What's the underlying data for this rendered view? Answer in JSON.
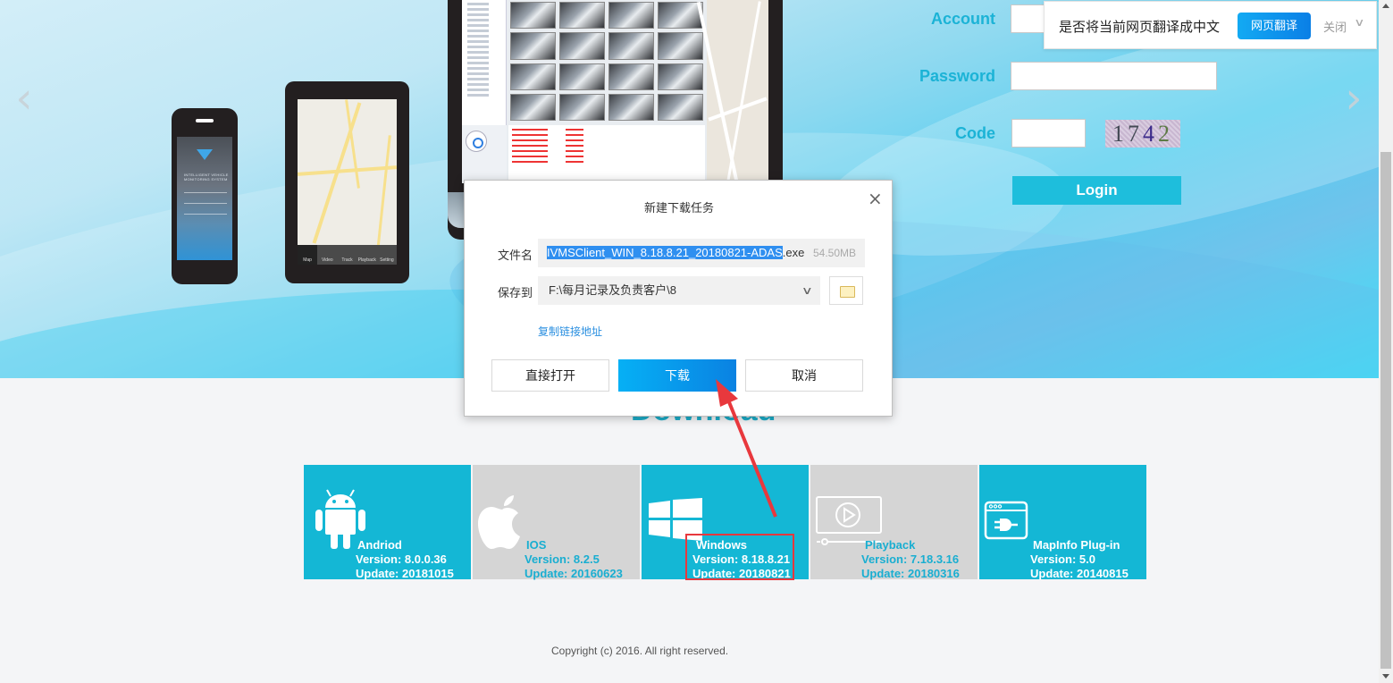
{
  "hero": {
    "prev_arrow": "‹",
    "next_arrow": "›",
    "phone_brand": "INTELLIGENT VEHICLE MONITORING SYSTEM",
    "tablet_tabs": [
      "Map",
      "Video",
      "Track",
      "Playback",
      "Setting"
    ]
  },
  "login": {
    "account_label": "Account",
    "password_label": "Password",
    "code_label": "Code",
    "account_value": "",
    "password_value": "",
    "code_value": "",
    "captcha_digits": [
      "1",
      "7",
      "4",
      "2"
    ],
    "login_button": "Login"
  },
  "translate_bar": {
    "prompt": "是否将当前网页翻译成中文",
    "translate_button": "网页翻译",
    "close_button": "关闭",
    "menu_chevron": "∨"
  },
  "dialog": {
    "title": "新建下载任务",
    "close_icon": "×",
    "filename_label": "文件名",
    "filename_selected": "IVMSClient_WIN_8.18.8.21_20180821-ADAS",
    "filename_ext": ".exe",
    "file_size": "54.50MB",
    "save_to_label": "保存到",
    "save_path": "F:\\每月记录及负责客户\\8",
    "path_chevron": "∨",
    "copy_link": "复制链接地址",
    "open_button": "直接打开",
    "download_button": "下载",
    "cancel_button": "取消"
  },
  "download": {
    "title": "Download",
    "tiles": [
      {
        "name": "Andriod",
        "version": "Version: 8.0.0.36",
        "update": "Update: 20181015",
        "icon": "android-icon",
        "color": "#14b7d5"
      },
      {
        "name": "IOS",
        "version": "Version: 8.2.5",
        "update": "Update: 20160623",
        "icon": "apple-icon",
        "color": "#d5d5d5"
      },
      {
        "name": "Windows",
        "version": "Version: 8.18.8.21",
        "update": "Update: 20180821",
        "icon": "windows-icon",
        "color": "#14b7d5"
      },
      {
        "name": "Playback",
        "version": "Version: 7.18.3.16",
        "update": "Update: 20180316",
        "icon": "playback-icon",
        "color": "#d5d5d5"
      },
      {
        "name": "MapInfo Plug-in",
        "version": "Version: 5.0",
        "update": "Update: 20140815",
        "icon": "plugin-icon",
        "color": "#14b7d5"
      }
    ]
  },
  "footer": {
    "copyright": "Copyright (c) 2016. All right reserved."
  },
  "colors": {
    "accent": "#1bb3d6",
    "tile_blue": "#14b7d5",
    "tile_grey": "#d5d5d5",
    "annotation_red": "#e8383d",
    "primary_button": "#0a82e2"
  }
}
